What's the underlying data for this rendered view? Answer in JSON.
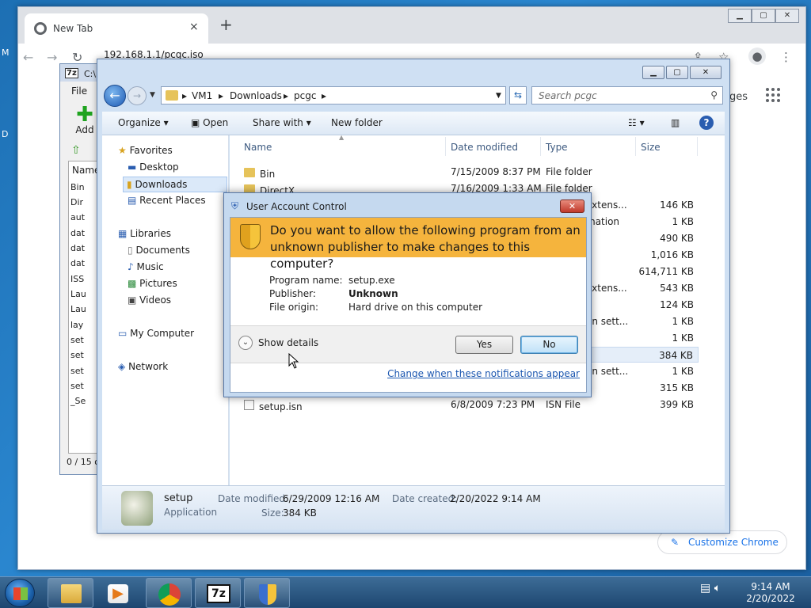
{
  "chrome": {
    "tab_title": "New Tab",
    "tab_close": "×",
    "new_tab": "+",
    "window_buttons": [
      "▁",
      "▢",
      "✕"
    ],
    "address": "192.168.1.1/pcgc.iso",
    "right_text": "ges",
    "customize_label": "Customize Chrome"
  },
  "desktop": {
    "left_chars": [
      "M",
      "D"
    ]
  },
  "zip": {
    "title": "C:\\",
    "menu": "File",
    "add_label": "Add",
    "column": "Name",
    "rows": [
      "Bin",
      "Dir",
      "aut",
      "dat",
      "dat",
      "dat",
      "ISS",
      "Lau",
      "Lau",
      "lay",
      "set",
      "set",
      "set",
      "set",
      "_Se"
    ],
    "status": "0 / 15 o"
  },
  "explorer": {
    "address": [
      "VM1",
      "Downloads",
      "pcgc"
    ],
    "search_placeholder": "Search pcgc",
    "commands": {
      "organize": "Organize",
      "open": "Open",
      "share": "Share with",
      "newfolder": "New folder"
    },
    "nav": {
      "favorites": "Favorites",
      "desktop": "Desktop",
      "downloads": "Downloads",
      "recent": "Recent Places",
      "libraries": "Libraries",
      "documents": "Documents",
      "music": "Music",
      "pictures": "Pictures",
      "videos": "Videos",
      "computer": "My Computer",
      "network": "Network"
    },
    "columns": {
      "name": "Name",
      "date": "Date modified",
      "type": "Type",
      "size": "Size"
    },
    "files": [
      {
        "name": "Bin",
        "date": "7/15/2009 8:37 PM",
        "type": "File folder",
        "size": ""
      },
      {
        "name": "DirectX",
        "date": "7/16/2009 1:33 AM",
        "type": "File folder",
        "size": ""
      },
      {
        "name": "",
        "date": "",
        "type": "extens...",
        "size": "146 KB"
      },
      {
        "name": "",
        "date": "",
        "type": "mation",
        "size": "1 KB"
      },
      {
        "name": "",
        "date": "",
        "type": "e",
        "size": "490 KB"
      },
      {
        "name": "",
        "date": "",
        "type": "",
        "size": "1,016 KB"
      },
      {
        "name": "",
        "date": "",
        "type": "",
        "size": "614,711 KB"
      },
      {
        "name": "",
        "date": "",
        "type": "extens...",
        "size": "543 KB"
      },
      {
        "name": "",
        "date": "",
        "type": "",
        "size": "124 KB"
      },
      {
        "name": "",
        "date": "",
        "type": "on sett...",
        "size": "1 KB"
      },
      {
        "name": "",
        "date": "",
        "type": "",
        "size": "1 KB"
      },
      {
        "name": "",
        "date": "",
        "type": "",
        "size": "384 KB"
      },
      {
        "name": "",
        "date": "",
        "type": "on sett...",
        "size": "1 KB"
      },
      {
        "name": "",
        "date": "",
        "type": "",
        "size": "315 KB"
      },
      {
        "name": "setup.isn",
        "date": "6/8/2009 7:23 PM",
        "type": "ISN File",
        "size": "399 KB"
      }
    ],
    "details": {
      "name": "setup",
      "kind": "Application",
      "modified_label": "Date modified:",
      "modified": "6/29/2009 12:16 AM",
      "created_label": "Date created:",
      "created": "2/20/2022 9:14 AM",
      "size_label": "Size:",
      "size": "384 KB"
    }
  },
  "uac": {
    "title": "User Account Control",
    "question": "Do you want to allow the following program from an unknown publisher to make changes to this computer?",
    "program_label": "Program name:",
    "program": "setup.exe",
    "publisher_label": "Publisher:",
    "publisher": "Unknown",
    "origin_label": "File origin:",
    "origin": "Hard drive on this computer",
    "show_details": "Show details",
    "yes": "Yes",
    "no": "No",
    "change_link": "Change when these notifications appear"
  },
  "taskbar": {
    "time": "9:14 AM",
    "date": "2/20/2022",
    "zip_label": "7z"
  }
}
